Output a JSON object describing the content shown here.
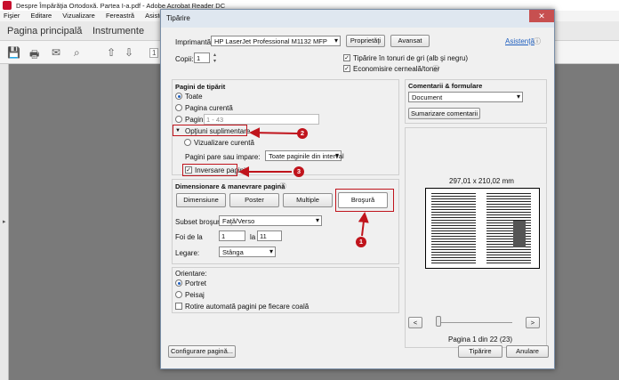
{
  "app": {
    "title": "Despre Împărăţia Ortodoxă. Partea I-a.pdf - Adobe Acrobat Reader DC",
    "menu": [
      "Fişier",
      "Editare",
      "Vizualizare",
      "Fereastră",
      "Asistenţă"
    ],
    "nav": {
      "home": "Pagina principală",
      "tools": "Instrumente"
    },
    "page_field": "1"
  },
  "dialog": {
    "title": "Tipărire",
    "printer_label": "Imprimantă:",
    "printer_value": "HP LaserJet Professional M1132 MFP",
    "properties_btn": "Proprietăţi",
    "advanced_btn": "Avansat",
    "help_link": "Asistenţă",
    "copies_label": "Copii:",
    "copies_value": "1",
    "grayscale_label": "Tipărire în tonuri de gri (alb şi negru)",
    "save_ink_label": "Economisire cerneală/toner",
    "pages": {
      "title": "Pagini de tipărit",
      "all": "Toate",
      "current": "Pagina curentă",
      "pages_label": "Pagini",
      "pages_value": "1 - 43",
      "more_options": "Opţiuni suplimentare",
      "current_view": "Vizualizare curentă",
      "odd_even_label": "Pagini pare sau impare:",
      "odd_even_value": "Toate paginile din interval",
      "reverse": "Inversare pagini"
    },
    "sizing": {
      "title": "Dimensionare & manevrare pagină",
      "size_btn": "Dimensiune",
      "poster_btn": "Poster",
      "multiple_btn": "Multiple",
      "booklet_btn": "Broşură",
      "subset_label": "Subset broşură:",
      "subset_value": "Faţă/Verso",
      "sheets_label": "Foi de la",
      "sheets_from": "1",
      "sheets_to_label": "la",
      "sheets_to": "11",
      "binding_label": "Legare:",
      "binding_value": "Stânga"
    },
    "orientation": {
      "title": "Orientare:",
      "portrait": "Portret",
      "landscape": "Peisaj",
      "auto_rotate": "Rotire automată pagini pe fiecare coală"
    },
    "comments": {
      "title": "Comentarii & formulare",
      "value": "Document",
      "summarize_btn": "Sumarizare comentarii"
    },
    "preview": {
      "size": "297,01 x 210,02 mm",
      "prev": "<",
      "next": ">",
      "page_info": "Pagina 1 din 22 (23)"
    },
    "page_setup_btn": "Configurare pagină...",
    "print_btn": "Tipărire",
    "cancel_btn": "Anulare"
  },
  "annotations": {
    "m1": "1",
    "m2": "2",
    "m3": "3"
  }
}
